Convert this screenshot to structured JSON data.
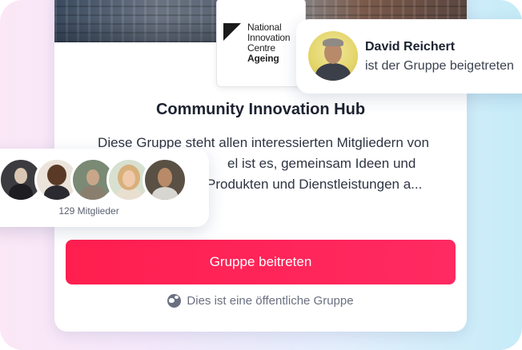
{
  "logo": {
    "line1": "National",
    "line2": "Innovation",
    "line3": "Centre",
    "line4": "Ageing"
  },
  "group": {
    "title": "Community Innovation Hub",
    "description": "Diese Gruppe steht allen interessierten Mitgliedern von ... Ziel ist es, gemeinsam Ideen und ... Produkten und Dienstleistungen a...",
    "description_lines": [
      "Diese Gruppe steht allen interessierten Mitgliedern von",
      "el ist es, gemeinsam Ideen und",
      "Produkten und Dienstleistungen a..."
    ],
    "join_label": "Gruppe beitreten",
    "visibility_text": "Dies ist eine öffentliche Gruppe",
    "visibility_icon": "globe-icon"
  },
  "notification": {
    "name": "David Reichert",
    "text": "ist der Gruppe beigetreten"
  },
  "members": {
    "count_label": "129 Mitglieder"
  },
  "colors": {
    "accent": "#ff2255",
    "title": "#1c2230",
    "muted": "#6a7080"
  }
}
